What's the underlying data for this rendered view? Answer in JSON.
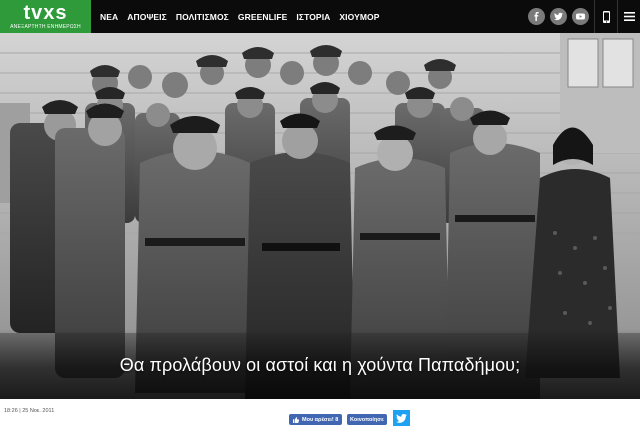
{
  "header": {
    "logo_text": "tvxs",
    "logo_tagline": "ΑΝΕΞΑΡΤΗΤΗ ΕΝΗΜΕΡΩΣΗ",
    "nav": [
      "ΝΕΑ",
      "ΑΠΟΨΕΙΣ",
      "ΠΟΛΙΤΙΣΜΟΣ",
      "GREENLIFE",
      "ΙΣΤΟΡΙΑ",
      "ΧΙΟΥΜΟΡ"
    ],
    "social_icons": [
      "facebook-icon",
      "twitter-icon",
      "youtube-icon"
    ],
    "utility_icons": [
      "mobile-icon",
      "menu-icon"
    ]
  },
  "article": {
    "headline": "Θα προλάβουν οι αστοί και η χούντα Παπαδήμου;",
    "date": "18:26 | 25 Νοε. 2011",
    "like_label": "Μου αρέσει! 8",
    "share_label": "Κοινοποίησε"
  },
  "colors": {
    "header_bg": "#0b0b0b",
    "logo_bg": "#2e9a39",
    "facebook": "#4267b2",
    "twitter": "#1da1f2"
  }
}
